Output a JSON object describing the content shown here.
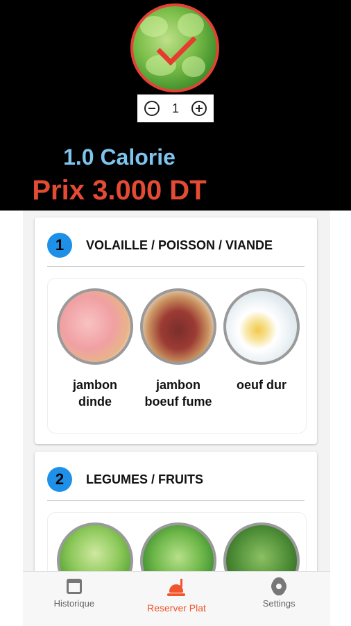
{
  "hero": {
    "quantity": "1",
    "calories": "1.0 Calorie",
    "price": "Prix 3.000 DT"
  },
  "categories": [
    {
      "number": "1",
      "title": "VOLAILLE / POISSON / VIANDE",
      "items": [
        {
          "label": "jambon\ndinde"
        },
        {
          "label": "jambon\nboeuf fume"
        },
        {
          "label": "oeuf dur"
        }
      ]
    },
    {
      "number": "2",
      "title": "LEGUMES / FRUITS",
      "items": [
        {
          "label": ""
        },
        {
          "label": ""
        },
        {
          "label": ""
        }
      ]
    }
  ],
  "nav": {
    "historique": "Historique",
    "reserver": "Reserver Plat",
    "settings": "Settings"
  },
  "colors": {
    "accent": "#f0552d",
    "price": "#e54b34",
    "calories": "#7dc4ef",
    "badge": "#1e90e8"
  }
}
